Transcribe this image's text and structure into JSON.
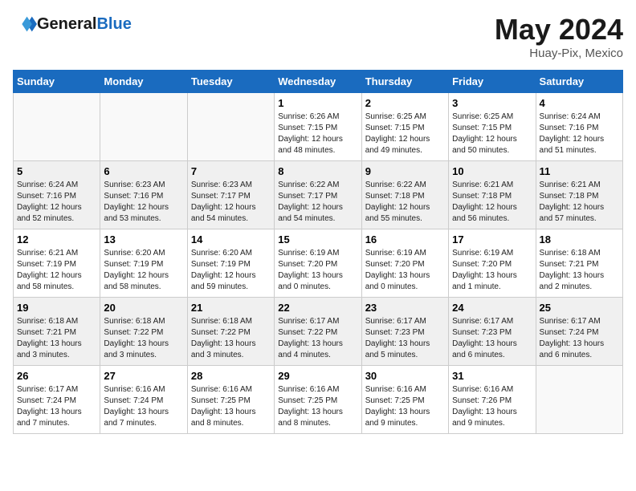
{
  "logo": {
    "text_general": "General",
    "text_blue": "Blue"
  },
  "title": "May 2024",
  "location": "Huay-Pix, Mexico",
  "days_of_week": [
    "Sunday",
    "Monday",
    "Tuesday",
    "Wednesday",
    "Thursday",
    "Friday",
    "Saturday"
  ],
  "weeks": [
    [
      {
        "day": "",
        "sunrise": "",
        "sunset": "",
        "daylight": ""
      },
      {
        "day": "",
        "sunrise": "",
        "sunset": "",
        "daylight": ""
      },
      {
        "day": "",
        "sunrise": "",
        "sunset": "",
        "daylight": ""
      },
      {
        "day": "1",
        "sunrise": "Sunrise: 6:26 AM",
        "sunset": "Sunset: 7:15 PM",
        "daylight": "Daylight: 12 hours and 48 minutes."
      },
      {
        "day": "2",
        "sunrise": "Sunrise: 6:25 AM",
        "sunset": "Sunset: 7:15 PM",
        "daylight": "Daylight: 12 hours and 49 minutes."
      },
      {
        "day": "3",
        "sunrise": "Sunrise: 6:25 AM",
        "sunset": "Sunset: 7:15 PM",
        "daylight": "Daylight: 12 hours and 50 minutes."
      },
      {
        "day": "4",
        "sunrise": "Sunrise: 6:24 AM",
        "sunset": "Sunset: 7:16 PM",
        "daylight": "Daylight: 12 hours and 51 minutes."
      }
    ],
    [
      {
        "day": "5",
        "sunrise": "Sunrise: 6:24 AM",
        "sunset": "Sunset: 7:16 PM",
        "daylight": "Daylight: 12 hours and 52 minutes."
      },
      {
        "day": "6",
        "sunrise": "Sunrise: 6:23 AM",
        "sunset": "Sunset: 7:16 PM",
        "daylight": "Daylight: 12 hours and 53 minutes."
      },
      {
        "day": "7",
        "sunrise": "Sunrise: 6:23 AM",
        "sunset": "Sunset: 7:17 PM",
        "daylight": "Daylight: 12 hours and 54 minutes."
      },
      {
        "day": "8",
        "sunrise": "Sunrise: 6:22 AM",
        "sunset": "Sunset: 7:17 PM",
        "daylight": "Daylight: 12 hours and 54 minutes."
      },
      {
        "day": "9",
        "sunrise": "Sunrise: 6:22 AM",
        "sunset": "Sunset: 7:18 PM",
        "daylight": "Daylight: 12 hours and 55 minutes."
      },
      {
        "day": "10",
        "sunrise": "Sunrise: 6:21 AM",
        "sunset": "Sunset: 7:18 PM",
        "daylight": "Daylight: 12 hours and 56 minutes."
      },
      {
        "day": "11",
        "sunrise": "Sunrise: 6:21 AM",
        "sunset": "Sunset: 7:18 PM",
        "daylight": "Daylight: 12 hours and 57 minutes."
      }
    ],
    [
      {
        "day": "12",
        "sunrise": "Sunrise: 6:21 AM",
        "sunset": "Sunset: 7:19 PM",
        "daylight": "Daylight: 12 hours and 58 minutes."
      },
      {
        "day": "13",
        "sunrise": "Sunrise: 6:20 AM",
        "sunset": "Sunset: 7:19 PM",
        "daylight": "Daylight: 12 hours and 58 minutes."
      },
      {
        "day": "14",
        "sunrise": "Sunrise: 6:20 AM",
        "sunset": "Sunset: 7:19 PM",
        "daylight": "Daylight: 12 hours and 59 minutes."
      },
      {
        "day": "15",
        "sunrise": "Sunrise: 6:19 AM",
        "sunset": "Sunset: 7:20 PM",
        "daylight": "Daylight: 13 hours and 0 minutes."
      },
      {
        "day": "16",
        "sunrise": "Sunrise: 6:19 AM",
        "sunset": "Sunset: 7:20 PM",
        "daylight": "Daylight: 13 hours and 0 minutes."
      },
      {
        "day": "17",
        "sunrise": "Sunrise: 6:19 AM",
        "sunset": "Sunset: 7:20 PM",
        "daylight": "Daylight: 13 hours and 1 minute."
      },
      {
        "day": "18",
        "sunrise": "Sunrise: 6:18 AM",
        "sunset": "Sunset: 7:21 PM",
        "daylight": "Daylight: 13 hours and 2 minutes."
      }
    ],
    [
      {
        "day": "19",
        "sunrise": "Sunrise: 6:18 AM",
        "sunset": "Sunset: 7:21 PM",
        "daylight": "Daylight: 13 hours and 3 minutes."
      },
      {
        "day": "20",
        "sunrise": "Sunrise: 6:18 AM",
        "sunset": "Sunset: 7:22 PM",
        "daylight": "Daylight: 13 hours and 3 minutes."
      },
      {
        "day": "21",
        "sunrise": "Sunrise: 6:18 AM",
        "sunset": "Sunset: 7:22 PM",
        "daylight": "Daylight: 13 hours and 3 minutes."
      },
      {
        "day": "22",
        "sunrise": "Sunrise: 6:17 AM",
        "sunset": "Sunset: 7:22 PM",
        "daylight": "Daylight: 13 hours and 4 minutes."
      },
      {
        "day": "23",
        "sunrise": "Sunrise: 6:17 AM",
        "sunset": "Sunset: 7:23 PM",
        "daylight": "Daylight: 13 hours and 5 minutes."
      },
      {
        "day": "24",
        "sunrise": "Sunrise: 6:17 AM",
        "sunset": "Sunset: 7:23 PM",
        "daylight": "Daylight: 13 hours and 6 minutes."
      },
      {
        "day": "25",
        "sunrise": "Sunrise: 6:17 AM",
        "sunset": "Sunset: 7:24 PM",
        "daylight": "Daylight: 13 hours and 6 minutes."
      }
    ],
    [
      {
        "day": "26",
        "sunrise": "Sunrise: 6:17 AM",
        "sunset": "Sunset: 7:24 PM",
        "daylight": "Daylight: 13 hours and 7 minutes."
      },
      {
        "day": "27",
        "sunrise": "Sunrise: 6:16 AM",
        "sunset": "Sunset: 7:24 PM",
        "daylight": "Daylight: 13 hours and 7 minutes."
      },
      {
        "day": "28",
        "sunrise": "Sunrise: 6:16 AM",
        "sunset": "Sunset: 7:25 PM",
        "daylight": "Daylight: 13 hours and 8 minutes."
      },
      {
        "day": "29",
        "sunrise": "Sunrise: 6:16 AM",
        "sunset": "Sunset: 7:25 PM",
        "daylight": "Daylight: 13 hours and 8 minutes."
      },
      {
        "day": "30",
        "sunrise": "Sunrise: 6:16 AM",
        "sunset": "Sunset: 7:25 PM",
        "daylight": "Daylight: 13 hours and 9 minutes."
      },
      {
        "day": "31",
        "sunrise": "Sunrise: 6:16 AM",
        "sunset": "Sunset: 7:26 PM",
        "daylight": "Daylight: 13 hours and 9 minutes."
      },
      {
        "day": "",
        "sunrise": "",
        "sunset": "",
        "daylight": ""
      }
    ]
  ]
}
